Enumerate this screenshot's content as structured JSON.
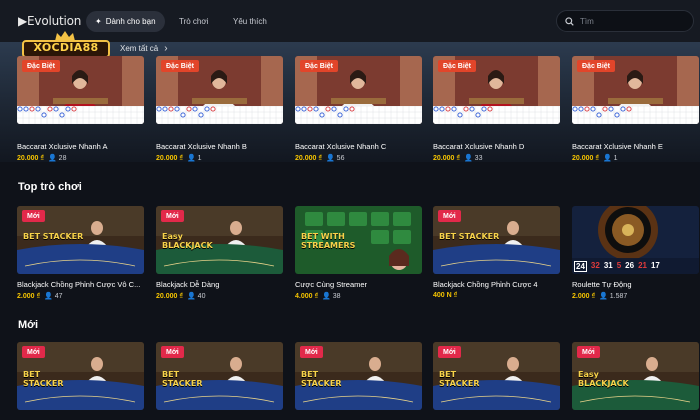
{
  "header": {
    "brand": "Evolution",
    "tabs": [
      {
        "label": "Dành cho bạn",
        "icon": "sparkle-icon"
      },
      {
        "label": "Trò chơi"
      },
      {
        "label": "Yêu thích"
      }
    ],
    "search_placeholder": "Tìm",
    "logo_text": "XOCDIA88"
  },
  "featured": {
    "see_all_label": "Xem tất cả",
    "cards": [
      {
        "badge": "Đặc Biệt",
        "title": "Baccarat Xclusive Nhanh A",
        "price": "20.000 ₫",
        "players": "28"
      },
      {
        "badge": "Đặc Biệt",
        "title": "Baccarat Xclusive Nhanh B",
        "price": "20.000 ₫",
        "players": "1"
      },
      {
        "badge": "Đặc Biệt",
        "title": "Baccarat Xclusive Nhanh C",
        "price": "20.000 ₫",
        "players": "56"
      },
      {
        "badge": "Đặc Biệt",
        "title": "Baccarat Xclusive Nhanh D",
        "price": "20.000 ₫",
        "players": "33"
      },
      {
        "badge": "Đặc Biệt",
        "title": "Baccarat Xclusive Nhanh E",
        "price": "20.000 ₫",
        "players": "1"
      }
    ]
  },
  "top_games": {
    "title": "Top trò chơi",
    "cards": [
      {
        "badge": "Mới",
        "title": "Blackjack Chồng Phỉnh Cược Vô C...",
        "price": "2.000 ₫",
        "players": "47",
        "art_text": "BET STACKER"
      },
      {
        "badge": "Mới",
        "title": "Blackjack Dễ Dàng",
        "price": "20.000 ₫",
        "players": "40",
        "art_text": "Easy BLACKJACK"
      },
      {
        "badge": "",
        "title": "Cược Cùng Streamer",
        "price": "4.000 ₫",
        "players": "38",
        "art_text": "BET WITH STREAMERS"
      },
      {
        "badge": "Mới",
        "title": "Blackjack Chồng Phỉnh Cược 4",
        "price": "400 N ₫",
        "players": "",
        "art_text": "BET STACKER"
      },
      {
        "badge": "",
        "title": "Roulette Tự Động",
        "price": "2.000 ₫",
        "players": "1.587",
        "roulette_numbers": [
          "24",
          "32",
          "31",
          "5",
          "26",
          "21",
          "17"
        ]
      }
    ]
  },
  "new_games": {
    "title": "Mới",
    "cards": [
      {
        "badge": "Mới",
        "art_text": "BET STACKER"
      },
      {
        "badge": "Mới",
        "art_text": "BET STACKER"
      },
      {
        "badge": "Mới",
        "art_text": "BET STACKER"
      },
      {
        "badge": "Mới",
        "art_text": "BET STACKER"
      },
      {
        "badge": "Mới",
        "art_text": "Easy BLACKJACK"
      }
    ]
  },
  "colors": {
    "background": "#0f1219",
    "price": "#f5c400",
    "badge_special": "#e2452a",
    "badge_new": "#e2294a"
  }
}
